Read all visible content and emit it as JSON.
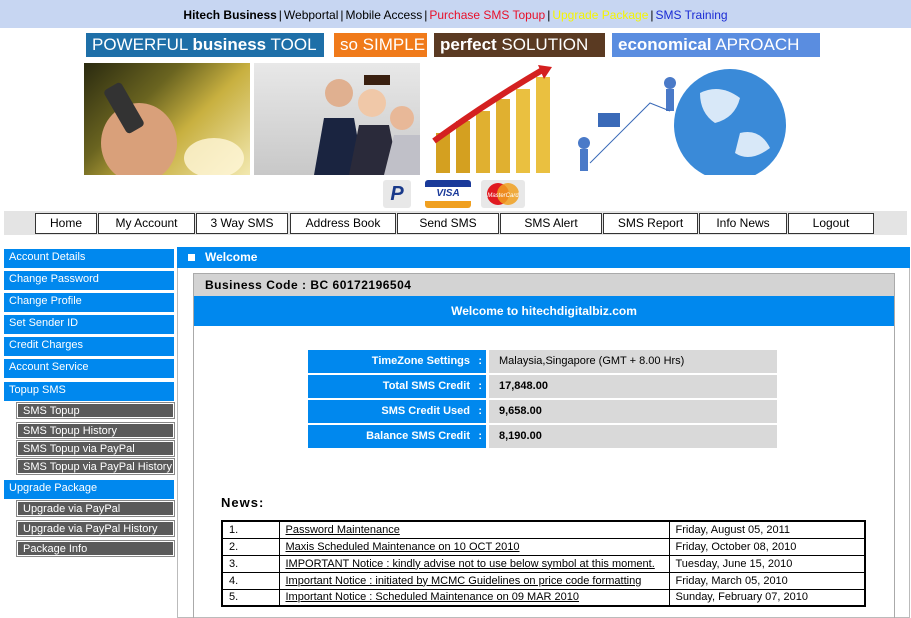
{
  "top_links": [
    {
      "label": "Hitech Business",
      "color": "#000000"
    },
    {
      "label": "Webportal",
      "color": "#000000"
    },
    {
      "label": "Mobile Access",
      "color": "#000000"
    },
    {
      "label": "Purchase SMS Topup",
      "color": "#e8102a"
    },
    {
      "label": "Upgrade Package",
      "color": "#f5f500"
    },
    {
      "label": "SMS Training",
      "color": "#1a2ad4"
    }
  ],
  "banner": {
    "tag1_pre": "POWERFUL ",
    "tag1_bold": "business",
    "tag1_post": " TOOL",
    "tag2": "so SIMPLE",
    "tag3_bold": "perfect",
    "tag3_post": " SOLUTION",
    "tag4_bold": "economical",
    "tag4_post": " APROACH",
    "colors": {
      "tag1": "#1e6fa8",
      "tag2": "#f07a1a",
      "tag3": "#5a3a22",
      "tag4": "#5a8de0"
    }
  },
  "payment": {
    "paypal": "P",
    "visa": "VISA",
    "mastercard": "MasterCard"
  },
  "nav": [
    "Home",
    "My Account",
    "3 Way SMS",
    "Address Book",
    "Send SMS",
    "SMS Alert",
    "SMS Report",
    "Info News",
    "Logout"
  ],
  "sidebar": {
    "account": [
      "Account Details",
      "Change Password",
      "Change Profile",
      "Set Sender ID",
      "Credit Charges",
      "Account Service"
    ],
    "topup_header": "Topup SMS",
    "topup": [
      "SMS Topup",
      "SMS Topup History",
      "SMS Topup via PayPal",
      "SMS Topup via PayPal History"
    ],
    "upgrade_header": "Upgrade Package",
    "upgrade": [
      "Upgrade via PayPal",
      "Upgrade via PayPal History",
      "Package Info"
    ]
  },
  "main": {
    "section_title": "Welcome",
    "business_code": "Business Code : BC  60172196504",
    "welcome_text": "Welcome to hitechdigitalbiz.com",
    "info": [
      {
        "label": "TimeZone Settings",
        "value": "Malaysia,Singapore (GMT + 8.00 Hrs)",
        "bold": false
      },
      {
        "label": "Total SMS Credit",
        "value": "17,848.00",
        "bold": true
      },
      {
        "label": "SMS Credit Used",
        "value": "9,658.00",
        "bold": true
      },
      {
        "label": "Balance SMS Credit",
        "value": "8,190.00",
        "bold": true
      }
    ],
    "colon": ":",
    "news_heading": "News:",
    "news": [
      {
        "num": "1.",
        "title": "Password Maintenance",
        "date": "Friday, August 05, 2011"
      },
      {
        "num": "2.",
        "title": "Maxis Scheduled Maintenance on 10 OCT 2010",
        "date": "Friday, October 08, 2010"
      },
      {
        "num": "3.",
        "title": "IMPORTANT Notice : kindly advise not to use below symbol at this moment.",
        "date": "Tuesday, June 15, 2010"
      },
      {
        "num": "4.",
        "title": "Important Notice : initiated by MCMC Guidelines on price code formatting",
        "date": "Friday, March 05, 2010"
      },
      {
        "num": "5.",
        "title": "Important Notice : Scheduled Maintenance on 09 MAR 2010",
        "date": "Sunday, February 07, 2010"
      }
    ]
  }
}
